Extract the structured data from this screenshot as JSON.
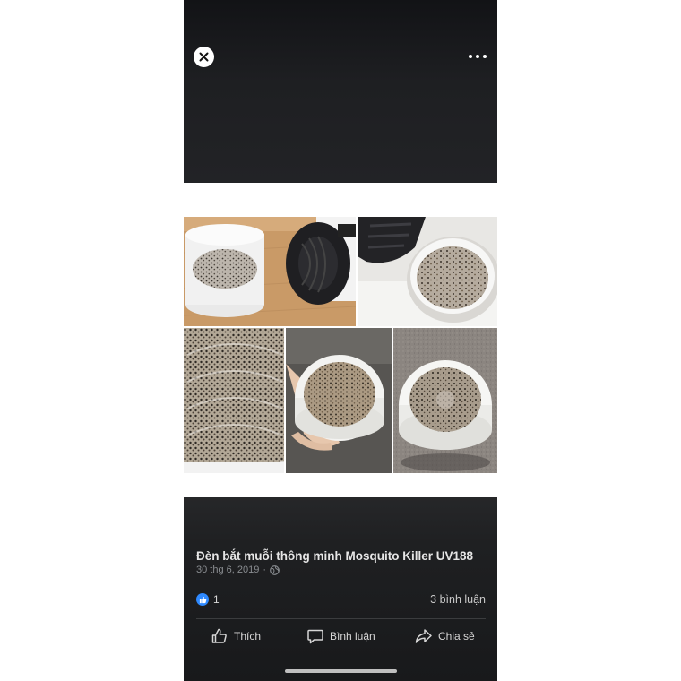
{
  "viewer": {
    "close_icon": "close-icon",
    "more_icon": "more-horizontal-icon"
  },
  "post": {
    "title": "Đèn bắt muỗi thông minh Mosquito Killer UV188",
    "date": "30 thg 6, 2019",
    "separator": "·",
    "audience_icon": "globe-icon",
    "reactions": {
      "icon": "like-badge-icon",
      "count": "1"
    },
    "comments_count": "3 bình luận"
  },
  "actions": [
    {
      "label": "Thích",
      "icon": "thumbs-up-icon"
    },
    {
      "label": "Bình luận",
      "icon": "comment-bubble-icon"
    },
    {
      "label": "Chia sẻ",
      "icon": "share-arrow-icon"
    }
  ],
  "colors": {
    "background_dark": "#1f2022",
    "accent_like": "#2e89ff",
    "text_primary": "#e6e6e6",
    "text_secondary": "#8a8d91"
  },
  "photo_collage": {
    "description_images": [
      "mosquito-trap-tray-1",
      "mosquito-trap-tray-2",
      "mosquito-trap-tray-3",
      "mosquito-trap-tray-4",
      "mosquito-trap-tray-5"
    ]
  }
}
